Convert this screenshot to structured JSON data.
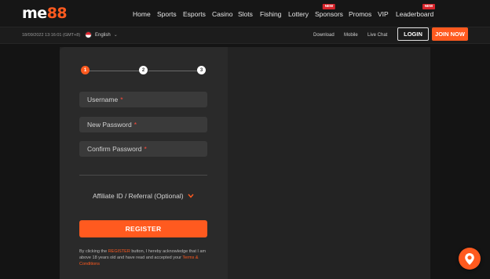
{
  "brand": {
    "logo_text": "me",
    "logo_num": "88",
    "accent": "#ff5a1f"
  },
  "nav": {
    "items": [
      {
        "label": "Home"
      },
      {
        "label": "Sports"
      },
      {
        "label": "Esports"
      },
      {
        "label": "Casino"
      },
      {
        "label": "Slots"
      },
      {
        "label": "Fishing"
      },
      {
        "label": "Lottery"
      },
      {
        "label": "Sponsors",
        "badge": "NEW"
      },
      {
        "label": "Promos"
      },
      {
        "label": "VIP"
      },
      {
        "label": "Leaderboard",
        "badge": "NEW"
      }
    ]
  },
  "subbar": {
    "datetime": "18/09/2022 13:16:01 (GMT+8)",
    "language": "English",
    "flag_icon": "singapore-flag-icon",
    "links": {
      "download": "Download",
      "mobile": "Mobile",
      "live_chat": "Live Chat"
    },
    "login": "LOGIN",
    "join": "JOIN NOW"
  },
  "register": {
    "steps": [
      "1",
      "2",
      "3"
    ],
    "active_step": 1,
    "fields": {
      "username": {
        "placeholder": "Username",
        "required": "*"
      },
      "new_password": {
        "placeholder": "New Password",
        "required": "*"
      },
      "confirm_password": {
        "placeholder": "Confirm Password",
        "required": "*"
      }
    },
    "affiliate_label": "Affiliate ID / Referral (Optional)",
    "affiliate_icon": "chevron-down-icon",
    "button": "REGISTER",
    "consent": {
      "part1": "By clicking the ",
      "highlight": "REGISTER",
      "part2": " button, I hereby acknowledge that I am above 18 years old and have read and accepted your ",
      "terms": "Terms & Conditions"
    }
  },
  "support": {
    "icon": "support-location-icon"
  }
}
